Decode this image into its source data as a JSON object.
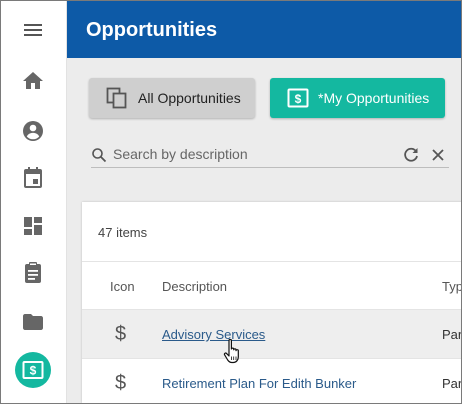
{
  "header": {
    "title": "Opportunities"
  },
  "filters": {
    "all_label": "All Opportunities",
    "my_label": "*My Opportunities"
  },
  "search": {
    "placeholder": "Search by description"
  },
  "list": {
    "count_label": "47 items",
    "columns": {
      "icon": "Icon",
      "description": "Description",
      "type": "Typ"
    },
    "rows": [
      {
        "icon": "$",
        "description": "Advisory Services",
        "type": "Par"
      },
      {
        "icon": "$",
        "description": "Retirement Plan For Edith Bunker",
        "type": "Par"
      }
    ]
  },
  "colors": {
    "topbar": "#0d5aa7",
    "accent": "#14b8a0"
  },
  "sidebar": {
    "icons": [
      "menu-icon",
      "home-icon",
      "person-icon",
      "calendar-icon",
      "dashboard-icon",
      "clipboard-icon",
      "folder-icon",
      "money-icon"
    ]
  }
}
